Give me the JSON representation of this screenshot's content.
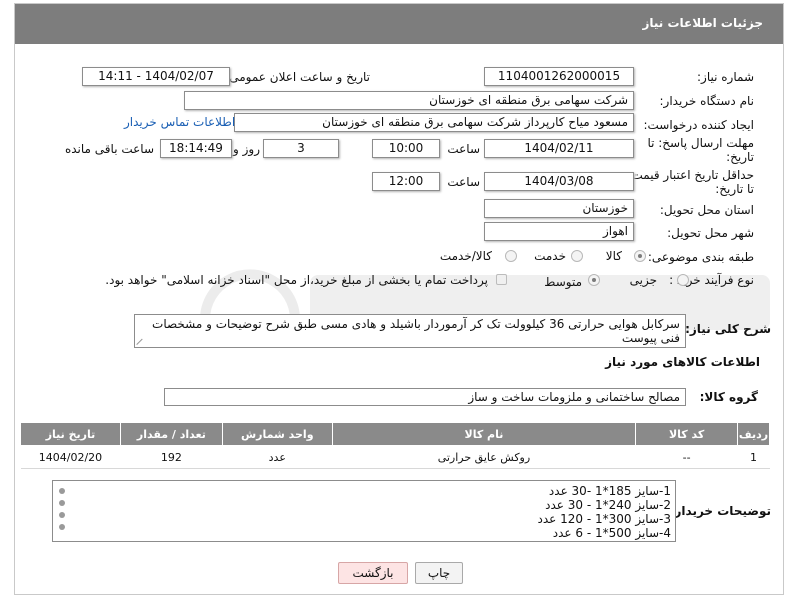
{
  "header": {
    "title": "جزئیات اطلاعات نیاز"
  },
  "fields": {
    "need_number_label": "شماره نیاز:",
    "need_number": "1104001262000015",
    "announce_label": "تاریخ و ساعت اعلان عمومی:",
    "announce_value": "1404/02/07 - 14:11",
    "buyer_org_label": "نام دستگاه خریدار:",
    "buyer_org": "شرکت سهامی برق منطقه ای خوزستان",
    "requester_label": "ایجاد کننده درخواست:",
    "requester": "مسعود میاح کارپرداز شرکت سهامی برق منطقه ای خوزستان",
    "contact_link": "اطلاعات تماس خریدار",
    "deadline_label_1": "مهلت ارسال پاسخ: تا",
    "deadline_label_2": "تاریخ:",
    "deadline_date": "1404/02/11",
    "time_label": "ساعت",
    "deadline_time": "10:00",
    "days_value": "3",
    "days_label": "روز و",
    "remaining_time": "18:14:49",
    "remaining_label": "ساعت باقی مانده",
    "validity_label_1": "حداقل تاریخ اعتبار قیمت:",
    "validity_label_2": "تا تاریخ:",
    "validity_date": "1404/03/08",
    "validity_time": "12:00",
    "province_label": "استان محل تحویل:",
    "province": "خوزستان",
    "city_label": "شهر محل تحویل:",
    "city": "اهواز",
    "category_label": "طبقه بندی موضوعی:",
    "category_options": [
      "کالا",
      "خدمت",
      "کالا/خدمت"
    ],
    "category_selected": "کالا",
    "process_label": "نوع فرآیند خرید :",
    "process_options": [
      "جزیی",
      "متوسط"
    ],
    "process_selected": "متوسط",
    "payment_note": "پرداخت تمام یا بخشی از مبلغ خرید،از محل \"اسناد خزانه اسلامی\" خواهد بود."
  },
  "description": {
    "label": "شرح کلی نیاز:",
    "text": "سرکابل هوایی حرارتی 36 کیلوولت تک کر آرموردار باشیلد و هادی مسی طبق شرح توضیحات و مشخصات فنی پیوست"
  },
  "goods_section": {
    "title": "اطلاعات کالاهای مورد نیاز",
    "group_label": "گروه کالا:",
    "group_value": "مصالح ساختمانی و ملزومات ساخت و ساز"
  },
  "table": {
    "headers": [
      "ردیف",
      "کد کالا",
      "نام کالا",
      "واحد شمارش",
      "تعداد / مقدار",
      "تاریخ نیاز"
    ],
    "rows": [
      [
        "1",
        "--",
        "روکش عایق حرارتی",
        "عدد",
        "192",
        "1404/02/20"
      ]
    ]
  },
  "buyer_notes": {
    "label": "توضیحات خریدار:",
    "lines": [
      "1-سایز  185*1  -30 عدد",
      "2-سایز   240*1 - 30 عدد",
      "3-سایز 300*1 - 120 عدد",
      "4-سایز 500*1 - 6 عدد"
    ]
  },
  "buttons": {
    "print": "چاپ",
    "back": "بازگشت"
  }
}
